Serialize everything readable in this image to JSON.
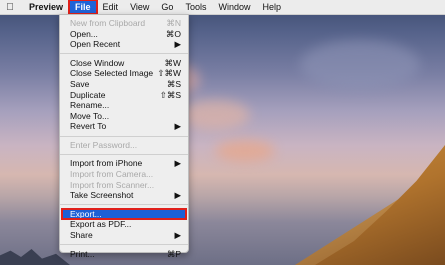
{
  "menubar": {
    "apple_icon": "apple-logo-icon",
    "app_name": "Preview",
    "menus": [
      "File",
      "Edit",
      "View",
      "Go",
      "Tools",
      "Window",
      "Help"
    ],
    "active_menu": "File"
  },
  "file_menu": {
    "new_from_clipboard": {
      "label": "New from Clipboard",
      "shortcut": "⌘N"
    },
    "open": {
      "label": "Open...",
      "shortcut": "⌘O"
    },
    "open_recent": {
      "label": "Open Recent",
      "arrow": "▶"
    },
    "close_window": {
      "label": "Close Window",
      "shortcut": "⌘W"
    },
    "close_selected_image": {
      "label": "Close Selected Image",
      "shortcut": "⇧⌘W"
    },
    "save": {
      "label": "Save",
      "shortcut": "⌘S"
    },
    "duplicate": {
      "label": "Duplicate",
      "shortcut": "⇧⌘S"
    },
    "rename": {
      "label": "Rename..."
    },
    "move_to": {
      "label": "Move To..."
    },
    "revert_to": {
      "label": "Revert To",
      "arrow": "▶"
    },
    "enter_password": {
      "label": "Enter Password..."
    },
    "import_from_iphone": {
      "label": "Import from iPhone",
      "arrow": "▶"
    },
    "import_from_camera": {
      "label": "Import from Camera..."
    },
    "import_from_scanner": {
      "label": "Import from Scanner..."
    },
    "take_screenshot": {
      "label": "Take Screenshot",
      "arrow": "▶"
    },
    "export": {
      "label": "Export..."
    },
    "export_as_pdf": {
      "label": "Export as PDF..."
    },
    "share": {
      "label": "Share",
      "arrow": "▶"
    },
    "print": {
      "label": "Print...",
      "shortcut": "⌘P"
    }
  },
  "colors": {
    "highlight": "#1d60d6",
    "annotation_red": "#e0201a",
    "menu_bg": "#eeeeee"
  }
}
